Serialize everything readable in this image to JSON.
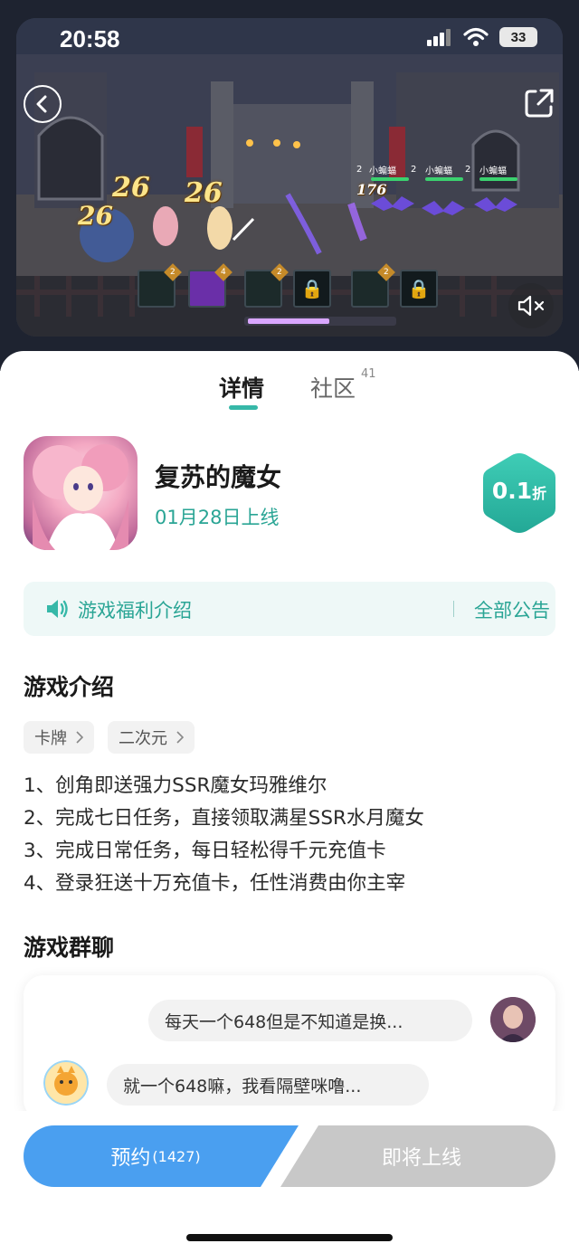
{
  "status_bar": {
    "time": "20:58",
    "battery": "33"
  },
  "game_scene": {
    "damage_numbers": [
      "26",
      "26",
      "26",
      "176"
    ],
    "enemy_names": [
      "小蝙蝠",
      "小蝙蝠",
      "小蝙蝠"
    ],
    "enemy_levels": [
      "2",
      "2",
      "2"
    ],
    "skill_levels": [
      "2",
      "4",
      "2",
      "2"
    ]
  },
  "tabs": [
    {
      "label": "详情",
      "active": true
    },
    {
      "label": "社区",
      "count": "41",
      "active": false
    }
  ],
  "game": {
    "name": "复苏的魔女",
    "launch_date": "01月28日上线",
    "discount_value": "0.1",
    "discount_unit": "折"
  },
  "notice": {
    "label": "游戏福利介绍",
    "all_label": "全部公告"
  },
  "intro": {
    "title": "游戏介绍",
    "tags": [
      "卡牌",
      "二次元"
    ],
    "lines": [
      "1、创角即送强力SSR魔女玛雅维尔",
      "2、完成七日任务，直接领取满星SSR水月魔女",
      "3、完成日常任务，每日轻松得千元充值卡",
      "4、登录狂送十万充值卡，任性消费由你主宰"
    ]
  },
  "group_chat": {
    "title": "游戏群聊",
    "messages": [
      {
        "side": "right",
        "text": "每天一个648但是不知道是换..."
      },
      {
        "side": "left",
        "text": "就一个648嘛，我看隔壁咪噜..."
      }
    ]
  },
  "actions": {
    "reserve_label": "预约",
    "reserve_count": "(1427)",
    "soon_label": "即将上线"
  },
  "colors": {
    "accent": "#2aa595",
    "primary_button": "#4a9ff0",
    "disabled_button": "#c8c8c8"
  }
}
